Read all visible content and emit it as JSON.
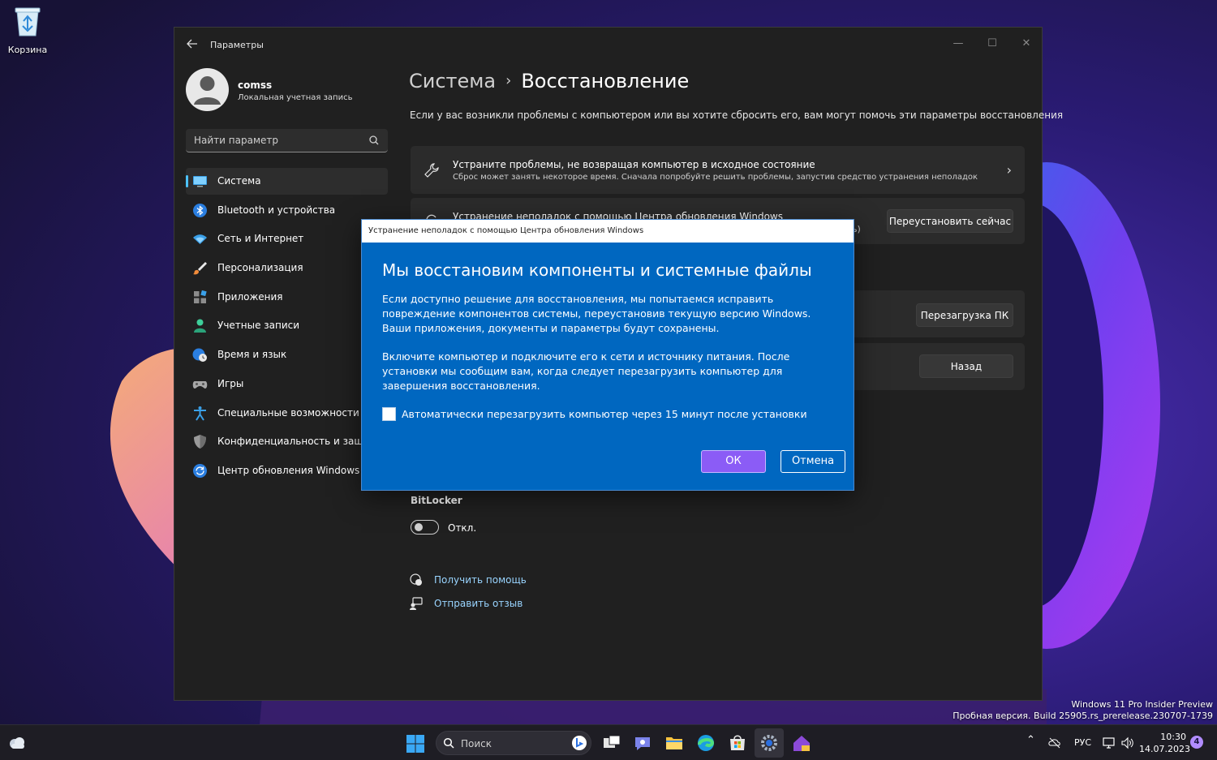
{
  "desktop": {
    "recycle_bin_label": "Корзина",
    "watermark_line1": "Windows 11 Pro Insider Preview",
    "watermark_line2": "Пробная версия. Build 25905.rs_prerelease.230707-1739"
  },
  "window": {
    "app_title": "Параметры",
    "controls": {
      "minimize": "—",
      "maximize": "☐",
      "close": "✕"
    }
  },
  "profile": {
    "name": "comss",
    "account_type": "Локальная учетная запись"
  },
  "search": {
    "placeholder": "Найти параметр"
  },
  "nav": {
    "items": [
      {
        "label": "Система",
        "icon": "system-icon",
        "active": true
      },
      {
        "label": "Bluetooth и устройства",
        "icon": "bluetooth-icon"
      },
      {
        "label": "Сеть и Интернет",
        "icon": "wifi-icon"
      },
      {
        "label": "Персонализация",
        "icon": "brush-icon"
      },
      {
        "label": "Приложения",
        "icon": "apps-icon"
      },
      {
        "label": "Учетные записи",
        "icon": "person-icon"
      },
      {
        "label": "Время и язык",
        "icon": "globe-clock-icon"
      },
      {
        "label": "Игры",
        "icon": "gamepad-icon"
      },
      {
        "label": "Специальные возможности",
        "icon": "accessibility-icon"
      },
      {
        "label": "Конфиденциальность и защита",
        "icon": "shield-icon"
      },
      {
        "label": "Центр обновления Windows",
        "icon": "update-icon"
      }
    ]
  },
  "main": {
    "breadcrumb_parent": "Система",
    "breadcrumb_sep": "›",
    "breadcrumb_current": "Восстановление",
    "intro": "Если у вас возникли проблемы с компьютером или вы хотите сбросить его, вам могут помочь эти параметры восстановления",
    "fix_card": {
      "title": "Устраните проблемы, не возвращая компьютер в исходное состояние",
      "subtitle": "Сброс может занять некоторое время. Сначала попробуйте решить проблемы, запустив средство устранения неполадок",
      "chevron": "›"
    },
    "update_card": {
      "title": "Устранение неполадок с помощью Центра обновления Windows",
      "peek_text": "ь)",
      "button": "Переустановить сейчас"
    },
    "reset_card": {
      "button": "Перезагрузка ПК"
    },
    "goback_card": {
      "button": "Назад"
    },
    "bitlocker": {
      "label": "BitLocker",
      "state": "Откл."
    },
    "links": {
      "help": "Получить помощь",
      "feedback": "Отправить отзыв"
    }
  },
  "dialog": {
    "title": "Устранение неполадок с помощью Центра обновления Windows",
    "heading": "Мы восстановим компоненты и системные файлы",
    "paragraph1": "Если доступно решение для восстановления, мы попытаемся исправить повреждение компонентов системы, переустановив текущую версию Windows. Ваши приложения, документы и параметры будут сохранены.",
    "paragraph2": "Включите компьютер и подключите его к сети и источнику питания. После установки мы сообщим вам, когда следует перезагрузить компьютер для завершения восстановления.",
    "checkbox_label": "Автоматически перезагрузить компьютер через 15 минут после установки",
    "checkbox_checked": false,
    "ok": "ОК",
    "cancel": "Отмена"
  },
  "taskbar": {
    "search_placeholder": "Поиск",
    "language": "РУС",
    "time": "10:30",
    "date": "14.07.2023",
    "notification_count": "4"
  },
  "colors": {
    "accent": "#4cc2ff",
    "dialog_bg": "#0067c0",
    "ok_button": "#8b5cf6",
    "link": "#99d4ff"
  }
}
